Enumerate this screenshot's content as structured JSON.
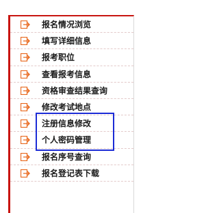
{
  "menu": {
    "items": [
      {
        "label": "报名情况浏览",
        "icon": "arrow-right-box-icon"
      },
      {
        "label": "填写详细信息",
        "icon": "arrow-right-box-icon"
      },
      {
        "label": "报考职位",
        "icon": "arrow-right-box-icon"
      },
      {
        "label": "查看报考信息",
        "icon": "arrow-right-box-icon"
      },
      {
        "label": "资格审查结果查询",
        "icon": "arrow-right-box-icon"
      },
      {
        "label": "修改考试地点",
        "icon": "arrow-right-box-icon"
      },
      {
        "label": "注册信息修改",
        "icon": "arrow-right-box-icon"
      },
      {
        "label": "个人密码管理",
        "icon": "arrow-right-box-icon"
      },
      {
        "label": "报名序号查询",
        "icon": "arrow-right-box-icon"
      },
      {
        "label": "报名登记表下载",
        "icon": "arrow-right-box-icon"
      }
    ]
  },
  "colors": {
    "accent_red": "#c8140f",
    "icon_orange": "#e8661a",
    "highlight_blue": "#1b2bd6"
  }
}
